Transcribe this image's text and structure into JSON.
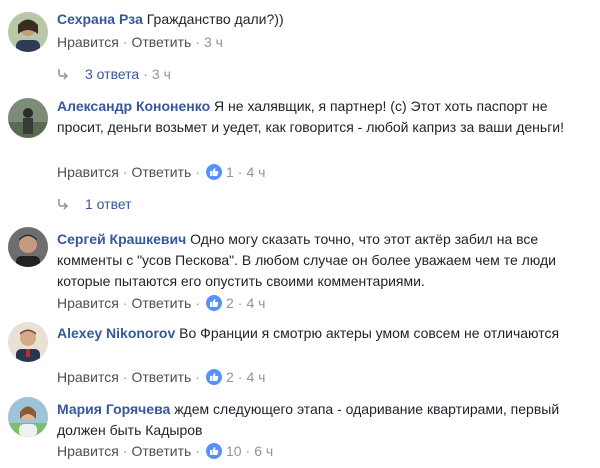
{
  "labels": {
    "like": "Нравится",
    "reply": "Ответить"
  },
  "comments": [
    {
      "author": "Сехрана Рза",
      "text": "Гражданство дали?))",
      "time": "3 ч",
      "likes": "",
      "replies": {
        "label": "3 ответа",
        "time": "3 ч"
      }
    },
    {
      "author": "Александр Кононенко",
      "text": "Я не халявщик, я партнер! (c) Этот хоть паспорт не просит, деньги возьмет и уедет, как говорится - любой каприз за ваши деньги!",
      "time": "4 ч",
      "likes": "1",
      "replies": {
        "label": "1 ответ",
        "time": ""
      }
    },
    {
      "author": "Сергей Крашкевич",
      "text": "Одно могу сказать точно, что этот актёр забил на все комменты с \"усов Пескова\". В любом случае он более уважаем чем те люди которые пытаются его опустить своими комментариями.",
      "time": "4 ч",
      "likes": "2",
      "replies": null
    },
    {
      "author": "Alexey Nikonorov",
      "text": "Во Франции я смотрю актеры умом совсем не отличаются",
      "time": "4 ч",
      "likes": "2",
      "replies": null
    },
    {
      "author": "Мария Горячева",
      "text": "ждем следующего этапа - одаривание квартирами, первый должен быть Кадыров",
      "time": "6 ч",
      "likes": "10",
      "replies": null
    }
  ]
}
